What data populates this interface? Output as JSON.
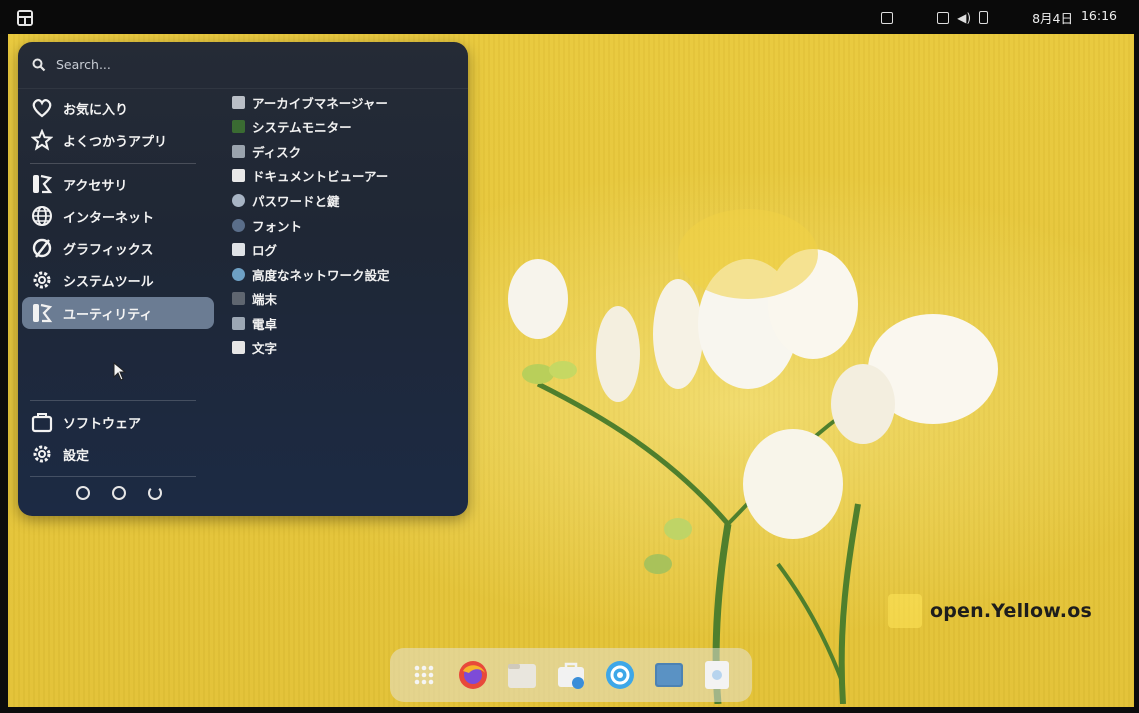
{
  "search": {
    "placeholder": "Search..."
  },
  "topbar": {
    "date": "8月4日",
    "time": "16:16"
  },
  "categories": [
    {
      "label": "お気に入り",
      "icon": "heart-icon"
    },
    {
      "label": "よくつかうアプリ",
      "icon": "star-icon"
    },
    {
      "label": "アクセサリ",
      "icon": "accessories-icon"
    },
    {
      "label": "インターネット",
      "icon": "globe-icon"
    },
    {
      "label": "グラフィックス",
      "icon": "graphics-icon"
    },
    {
      "label": "システムツール",
      "icon": "gear-icon"
    },
    {
      "label": "ユーティリティ",
      "icon": "utilities-icon",
      "selected": true
    }
  ],
  "bottom": [
    {
      "label": "ソフトウェア",
      "icon": "software-bag-icon"
    },
    {
      "label": "設定",
      "icon": "gear-icon"
    }
  ],
  "apps": [
    {
      "label": "アーカイブマネージャー",
      "icon": "archive-icon",
      "color": "#b9bec6"
    },
    {
      "label": "システムモニター",
      "icon": "system-monitor-icon",
      "color": "#3a6b32"
    },
    {
      "label": "ディスク",
      "icon": "disk-icon",
      "color": "#9aa3ad"
    },
    {
      "label": "ドキュメントビューアー",
      "icon": "document-viewer-icon",
      "color": "#e8e8e8"
    },
    {
      "label": "パスワードと鍵",
      "icon": "key-icon",
      "color": "#a7b4c4"
    },
    {
      "label": "フォント",
      "icon": "font-icon",
      "color": "#5a6e8a"
    },
    {
      "label": "ログ",
      "icon": "log-icon",
      "color": "#dfe2e6"
    },
    {
      "label": "高度なネットワーク設定",
      "icon": "network-icon",
      "color": "#6ea0c4"
    },
    {
      "label": "端末",
      "icon": "terminal-icon",
      "color": "#5f6670"
    },
    {
      "label": "電卓",
      "icon": "calculator-icon",
      "color": "#9ca7b4"
    },
    {
      "label": "文字",
      "icon": "characters-icon",
      "color": "#e6e6e6"
    }
  ],
  "brand": {
    "text": "open.Yellow.os"
  },
  "dock": [
    {
      "icon": "app-grid-icon"
    },
    {
      "icon": "firefox-icon"
    },
    {
      "icon": "files-icon"
    },
    {
      "icon": "software-icon"
    },
    {
      "icon": "settings-icon"
    },
    {
      "icon": "terminal-icon"
    },
    {
      "icon": "text-editor-icon"
    }
  ]
}
